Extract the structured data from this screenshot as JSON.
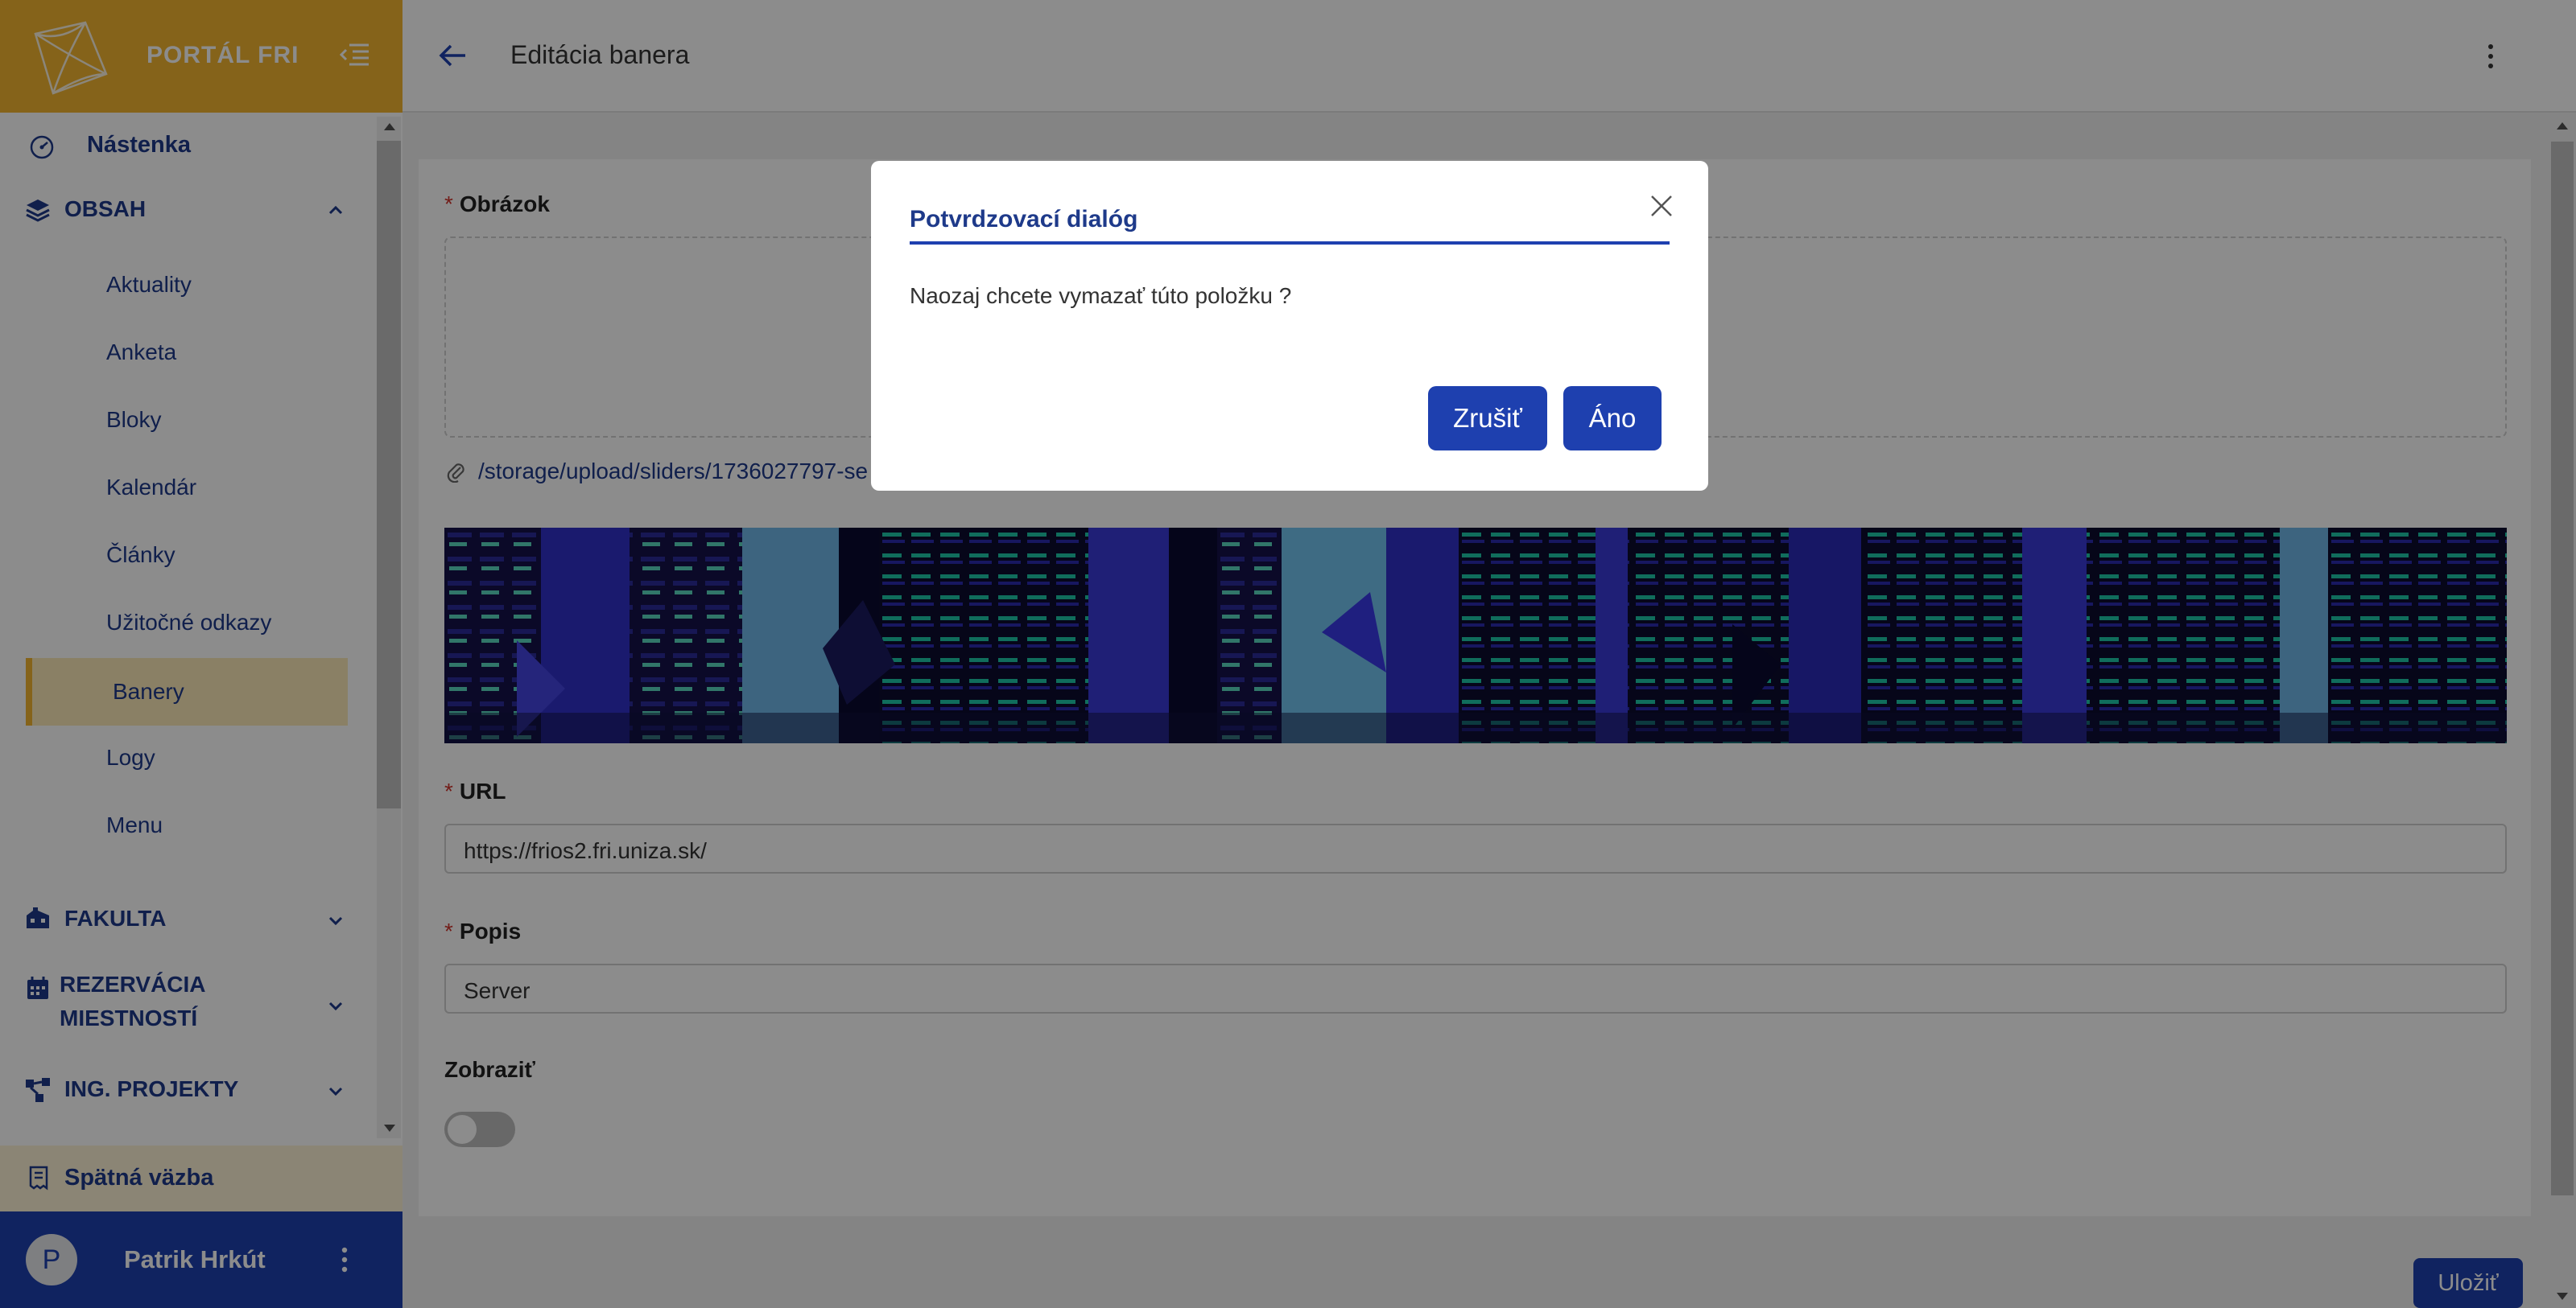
{
  "sidebar": {
    "title": "PORTÁL FRI",
    "dashboard": "Nástenka",
    "content_section": "OBSAH",
    "content_items": [
      "Aktuality",
      "Anketa",
      "Bloky",
      "Kalendár",
      "Články",
      "Užitočné odkazy",
      "Banery",
      "Logy",
      "Menu"
    ],
    "active_item": "Banery",
    "faculty_section": "FAKULTA",
    "reservation_section_line1": "REZERVÁCIA",
    "reservation_section_line2": "MIESTNOSTÍ",
    "projects_section": "ING. PROJEKTY",
    "feedback": "Spätná väzba",
    "user_initial": "P",
    "user_name": "Patrik Hrkút"
  },
  "header": {
    "title": "Editácia banera"
  },
  "form": {
    "image_label": "Obrázok",
    "file_path": "/storage/upload/sliders/1736027797-se",
    "url_label": "URL",
    "url_value": "https://frios2.fri.uniza.sk/",
    "description_label": "Popis",
    "description_value": "Server",
    "show_label": "Zobraziť",
    "show_enabled": false,
    "save_label": "Uložiť"
  },
  "dialog": {
    "title": "Potvrdzovací dialóg",
    "message": "Naozaj chcete vymazať túto položku ?",
    "cancel_label": "Zrušiť",
    "confirm_label": "Áno"
  },
  "colors": {
    "brand_yellow": "#f2b530",
    "primary_blue": "#1e40af",
    "required_red": "#d0342c"
  },
  "icons": {
    "dashboard": "gauge-icon",
    "content": "layers-icon",
    "faculty": "building-icon",
    "reservation": "calendar-icon",
    "projects": "network-icon",
    "feedback": "receipt-icon",
    "attachment": "paperclip-icon"
  }
}
